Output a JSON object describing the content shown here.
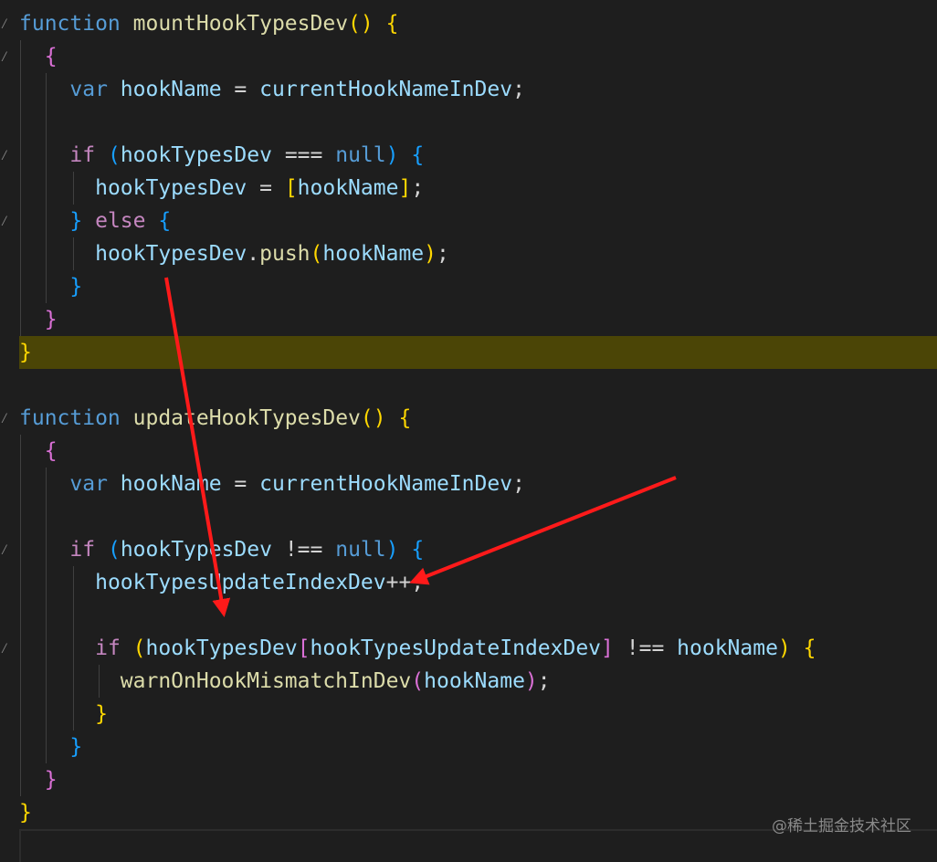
{
  "editor": {
    "lines": [
      [
        [
          "kw",
          "function"
        ],
        [
          "plain",
          " "
        ],
        [
          "fn",
          "mountHookTypesDev"
        ],
        [
          "b1",
          "()"
        ],
        [
          "plain",
          " "
        ],
        [
          "b1",
          "{"
        ]
      ],
      [
        [
          "plain",
          "  "
        ],
        [
          "b2",
          "{"
        ]
      ],
      [
        [
          "plain",
          "    "
        ],
        [
          "kw",
          "var"
        ],
        [
          "plain",
          " "
        ],
        [
          "var",
          "hookName"
        ],
        [
          "plain",
          " = "
        ],
        [
          "var",
          "currentHookNameInDev"
        ],
        [
          "plain",
          ";"
        ]
      ],
      [],
      [
        [
          "plain",
          "    "
        ],
        [
          "kw-ctl",
          "if"
        ],
        [
          "plain",
          " "
        ],
        [
          "b3",
          "("
        ],
        [
          "var",
          "hookTypesDev"
        ],
        [
          "plain",
          " === "
        ],
        [
          "kw",
          "null"
        ],
        [
          "b3",
          ")"
        ],
        [
          "plain",
          " "
        ],
        [
          "b3",
          "{"
        ]
      ],
      [
        [
          "plain",
          "      "
        ],
        [
          "var",
          "hookTypesDev"
        ],
        [
          "plain",
          " = "
        ],
        [
          "b1",
          "["
        ],
        [
          "var",
          "hookName"
        ],
        [
          "b1",
          "]"
        ],
        [
          "plain",
          ";"
        ]
      ],
      [
        [
          "plain",
          "    "
        ],
        [
          "b3",
          "}"
        ],
        [
          "plain",
          " "
        ],
        [
          "kw-ctl",
          "else"
        ],
        [
          "plain",
          " "
        ],
        [
          "b3",
          "{"
        ]
      ],
      [
        [
          "plain",
          "      "
        ],
        [
          "var",
          "hookTypesDev"
        ],
        [
          "plain",
          "."
        ],
        [
          "fn",
          "push"
        ],
        [
          "b1",
          "("
        ],
        [
          "var",
          "hookName"
        ],
        [
          "b1",
          ")"
        ],
        [
          "plain",
          ";"
        ]
      ],
      [
        [
          "plain",
          "    "
        ],
        [
          "b3",
          "}"
        ]
      ],
      [
        [
          "plain",
          "  "
        ],
        [
          "b2",
          "}"
        ]
      ],
      [
        [
          "b1",
          "}"
        ]
      ],
      [],
      [
        [
          "kw",
          "function"
        ],
        [
          "plain",
          " "
        ],
        [
          "fn",
          "updateHookTypesDev"
        ],
        [
          "b1",
          "()"
        ],
        [
          "plain",
          " "
        ],
        [
          "b1",
          "{"
        ]
      ],
      [
        [
          "plain",
          "  "
        ],
        [
          "b2",
          "{"
        ]
      ],
      [
        [
          "plain",
          "    "
        ],
        [
          "kw",
          "var"
        ],
        [
          "plain",
          " "
        ],
        [
          "var",
          "hookName"
        ],
        [
          "plain",
          " = "
        ],
        [
          "var",
          "currentHookNameInDev"
        ],
        [
          "plain",
          ";"
        ]
      ],
      [],
      [
        [
          "plain",
          "    "
        ],
        [
          "kw-ctl",
          "if"
        ],
        [
          "plain",
          " "
        ],
        [
          "b3",
          "("
        ],
        [
          "var",
          "hookTypesDev"
        ],
        [
          "plain",
          " !== "
        ],
        [
          "kw",
          "null"
        ],
        [
          "b3",
          ")"
        ],
        [
          "plain",
          " "
        ],
        [
          "b3",
          "{"
        ]
      ],
      [
        [
          "plain",
          "      "
        ],
        [
          "var",
          "hookTypesUpdateIndexDev"
        ],
        [
          "plain",
          "++;"
        ]
      ],
      [],
      [
        [
          "plain",
          "      "
        ],
        [
          "kw-ctl",
          "if"
        ],
        [
          "plain",
          " "
        ],
        [
          "b1",
          "("
        ],
        [
          "var",
          "hookTypesDev"
        ],
        [
          "b2",
          "["
        ],
        [
          "var",
          "hookTypesUpdateIndexDev"
        ],
        [
          "b2",
          "]"
        ],
        [
          "plain",
          " !== "
        ],
        [
          "var",
          "hookName"
        ],
        [
          "b1",
          ")"
        ],
        [
          "plain",
          " "
        ],
        [
          "b1",
          "{"
        ]
      ],
      [
        [
          "plain",
          "        "
        ],
        [
          "fn",
          "warnOnHookMismatchInDev"
        ],
        [
          "b2",
          "("
        ],
        [
          "var",
          "hookName"
        ],
        [
          "b2",
          ")"
        ],
        [
          "plain",
          ";"
        ]
      ],
      [
        [
          "plain",
          "      "
        ],
        [
          "b1",
          "}"
        ]
      ],
      [
        [
          "plain",
          "    "
        ],
        [
          "b3",
          "}"
        ]
      ],
      [
        [
          "plain",
          "  "
        ],
        [
          "b2",
          "}"
        ]
      ],
      [
        [
          "b1",
          "}"
        ]
      ]
    ],
    "fold_lines": [
      1,
      4,
      6,
      16,
      19
    ],
    "highlight_line": 10
  },
  "watermark": "@稀土掘金技术社区",
  "colors": {
    "background": "#1e1e1e",
    "arrow": "#ff1a1a",
    "line_highlight": "#4b4506"
  }
}
